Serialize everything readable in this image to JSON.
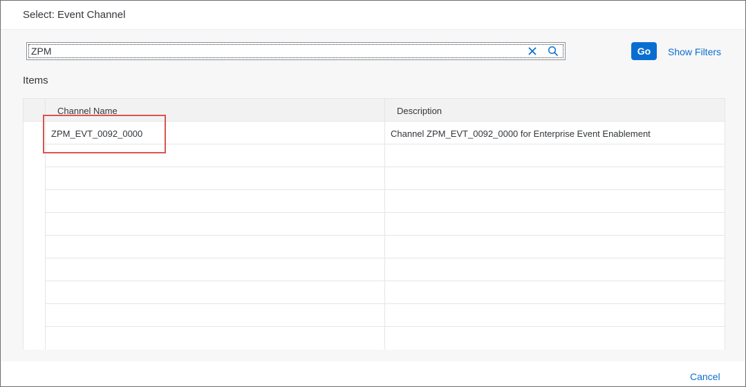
{
  "dialog": {
    "title": "Select: Event Channel"
  },
  "search": {
    "value": "ZPM",
    "clear_icon": "close-icon",
    "search_icon": "search-icon"
  },
  "toolbar": {
    "go_label": "Go",
    "show_filters_label": "Show Filters"
  },
  "items_label": "Items",
  "table": {
    "columns": [
      "Channel Name",
      "Description"
    ],
    "rows": [
      {
        "name": "ZPM_EVT_0092_0000",
        "description": "Channel ZPM_EVT_0092_0000 for Enterprise Event Enablement"
      }
    ],
    "empty_rows": 9,
    "highlight_color": "#d9534f"
  },
  "footer": {
    "cancel_label": "Cancel"
  },
  "colors": {
    "accent": "#0a6ed1",
    "text": "#32363a",
    "body_bg": "#f7f7f7"
  }
}
